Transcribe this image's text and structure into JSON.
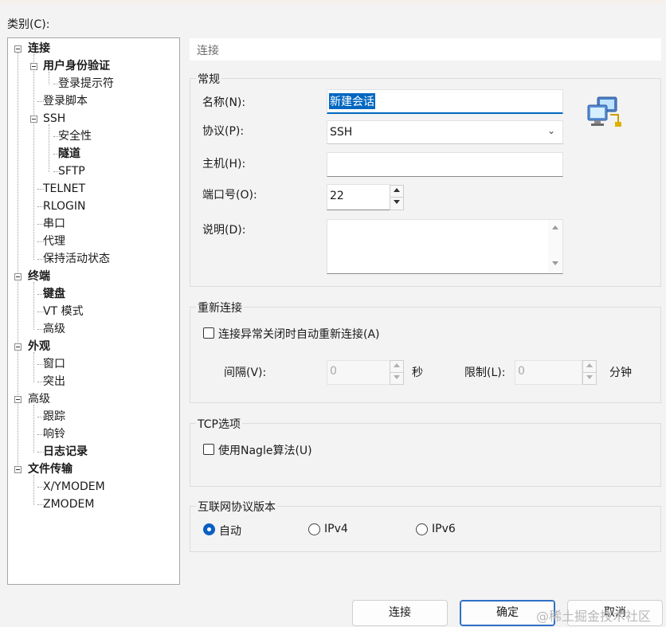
{
  "category_label": "类别(C):",
  "tree": [
    {
      "label": "连接",
      "bold": true
    },
    {
      "label": "用户身份验证",
      "bold": true
    },
    {
      "label": "登录提示符",
      "bold": false
    },
    {
      "label": "登录脚本",
      "bold": false
    },
    {
      "label": "SSH",
      "bold": false
    },
    {
      "label": "安全性",
      "bold": false
    },
    {
      "label": "隧道",
      "bold": true
    },
    {
      "label": "SFTP",
      "bold": false
    },
    {
      "label": "TELNET",
      "bold": false
    },
    {
      "label": "RLOGIN",
      "bold": false
    },
    {
      "label": "串口",
      "bold": false
    },
    {
      "label": "代理",
      "bold": false
    },
    {
      "label": "保持活动状态",
      "bold": false
    },
    {
      "label": "终端",
      "bold": true
    },
    {
      "label": "键盘",
      "bold": true
    },
    {
      "label": "VT 模式",
      "bold": false
    },
    {
      "label": "高级",
      "bold": false
    },
    {
      "label": "外观",
      "bold": true
    },
    {
      "label": "窗口",
      "bold": false
    },
    {
      "label": "突出",
      "bold": false
    },
    {
      "label": "高级",
      "bold": false
    },
    {
      "label": "跟踪",
      "bold": false
    },
    {
      "label": "响铃",
      "bold": false
    },
    {
      "label": "日志记录",
      "bold": true
    },
    {
      "label": "文件传输",
      "bold": true
    },
    {
      "label": "X/YMODEM",
      "bold": false
    },
    {
      "label": "ZMODEM",
      "bold": false
    }
  ],
  "header": {
    "title": "连接"
  },
  "general": {
    "title": "常规",
    "name_label": "名称(N):",
    "name_value": "新建会话",
    "protocol_label": "协议(P):",
    "protocol_value": "SSH",
    "host_label": "主机(H):",
    "host_value": "",
    "port_label": "端口号(O):",
    "port_value": "22",
    "desc_label": "说明(D):",
    "desc_value": "",
    "icon": "network-computers-icon"
  },
  "reconnect": {
    "title": "重新连接",
    "checkbox_label": "连接异常关闭时自动重新连接(A)",
    "checked": false,
    "interval_label": "间隔(V):",
    "interval_value": "0",
    "interval_unit": "秒",
    "limit_label": "限制(L):",
    "limit_value": "0",
    "limit_unit": "分钟"
  },
  "tcp": {
    "title": "TCP选项",
    "nagle_label": "使用Nagle算法(U)",
    "checked": false
  },
  "ip_version": {
    "title": "互联网协议版本",
    "options": [
      "自动",
      "IPv4",
      "IPv6"
    ],
    "selected": "自动"
  },
  "buttons": {
    "connect": "连接",
    "ok": "确定",
    "cancel": "取消"
  },
  "watermark": "@稀土掘金技术社区",
  "colors": {
    "accent": "#0067c0",
    "default_button_border": "#2f6fc4"
  }
}
